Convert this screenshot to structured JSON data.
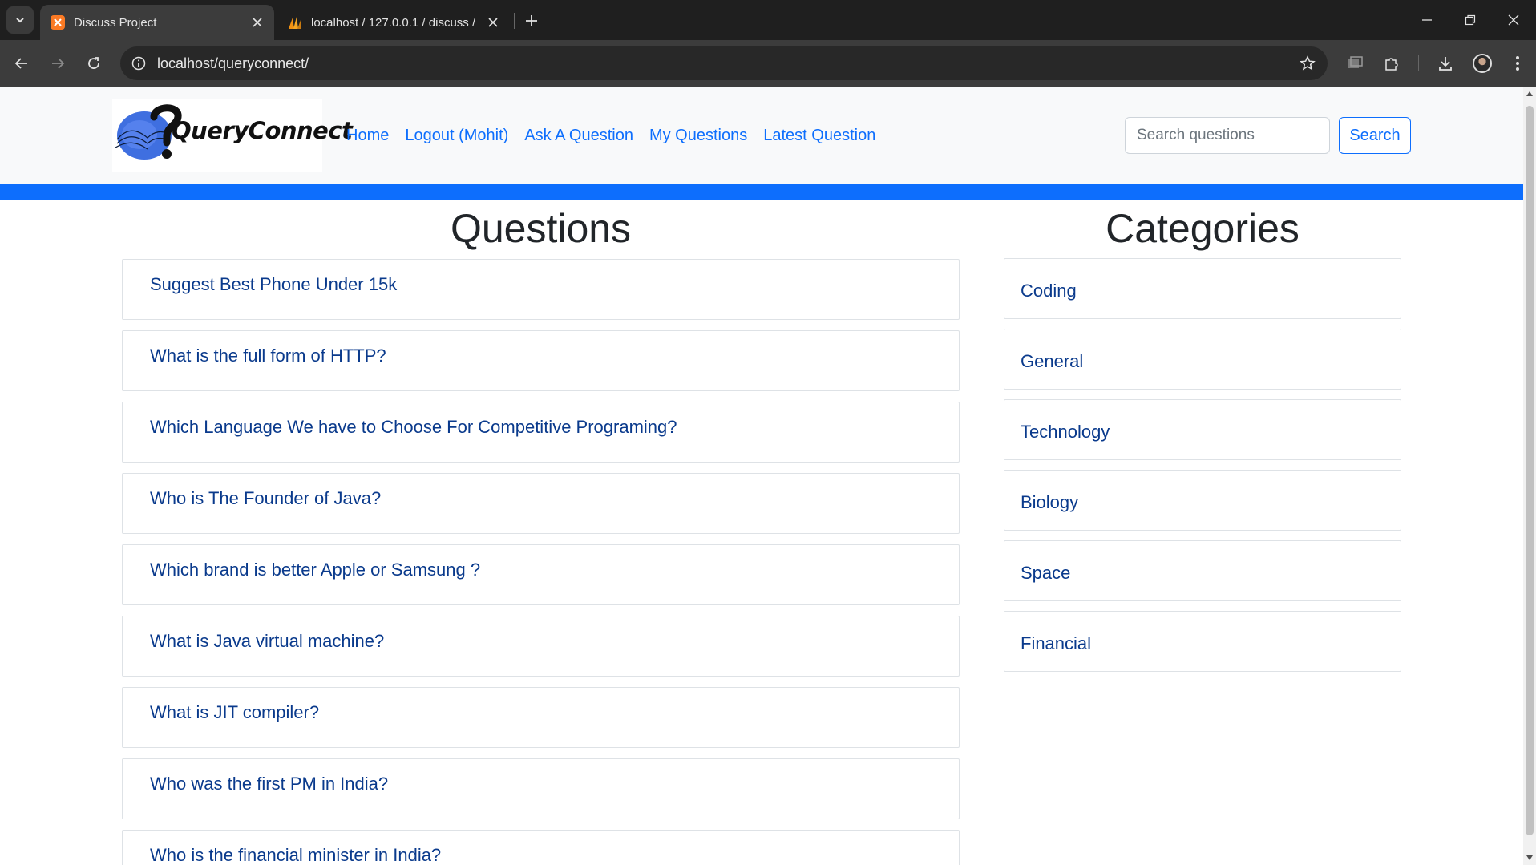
{
  "browser": {
    "tabs": [
      {
        "title": "Discuss Project",
        "active": true,
        "favicon": "xampp-icon"
      },
      {
        "title": "localhost / 127.0.0.1 / discuss /",
        "active": false,
        "favicon": "phpmyadmin-icon"
      }
    ],
    "url": "localhost/queryconnect/"
  },
  "site": {
    "logo_text": "QueryConnect",
    "nav": [
      "Home",
      "Logout (Mohit)",
      "Ask A Question",
      "My Questions",
      "Latest Question"
    ],
    "search": {
      "placeholder": "Search questions",
      "button": "Search"
    }
  },
  "questions": {
    "heading": "Questions",
    "items": [
      "Suggest Best Phone Under 15k",
      "What is the full form of HTTP?",
      "Which Language We have to Choose For Competitive Programing?",
      "Who is The Founder of Java?",
      "Which brand is better Apple or Samsung ?",
      "What is Java virtual machine?",
      "What is JIT compiler?",
      "Who was the first PM in India?",
      "Who is the financial minister in India?"
    ]
  },
  "categories": {
    "heading": "Categories",
    "items": [
      "Coding",
      "General",
      "Technology",
      "Biology",
      "Space",
      "Financial"
    ]
  },
  "colors": {
    "brand_blue": "#0d6efd",
    "link_dark_blue": "#0a3a8c",
    "chrome_dark": "#1f1f1f"
  }
}
